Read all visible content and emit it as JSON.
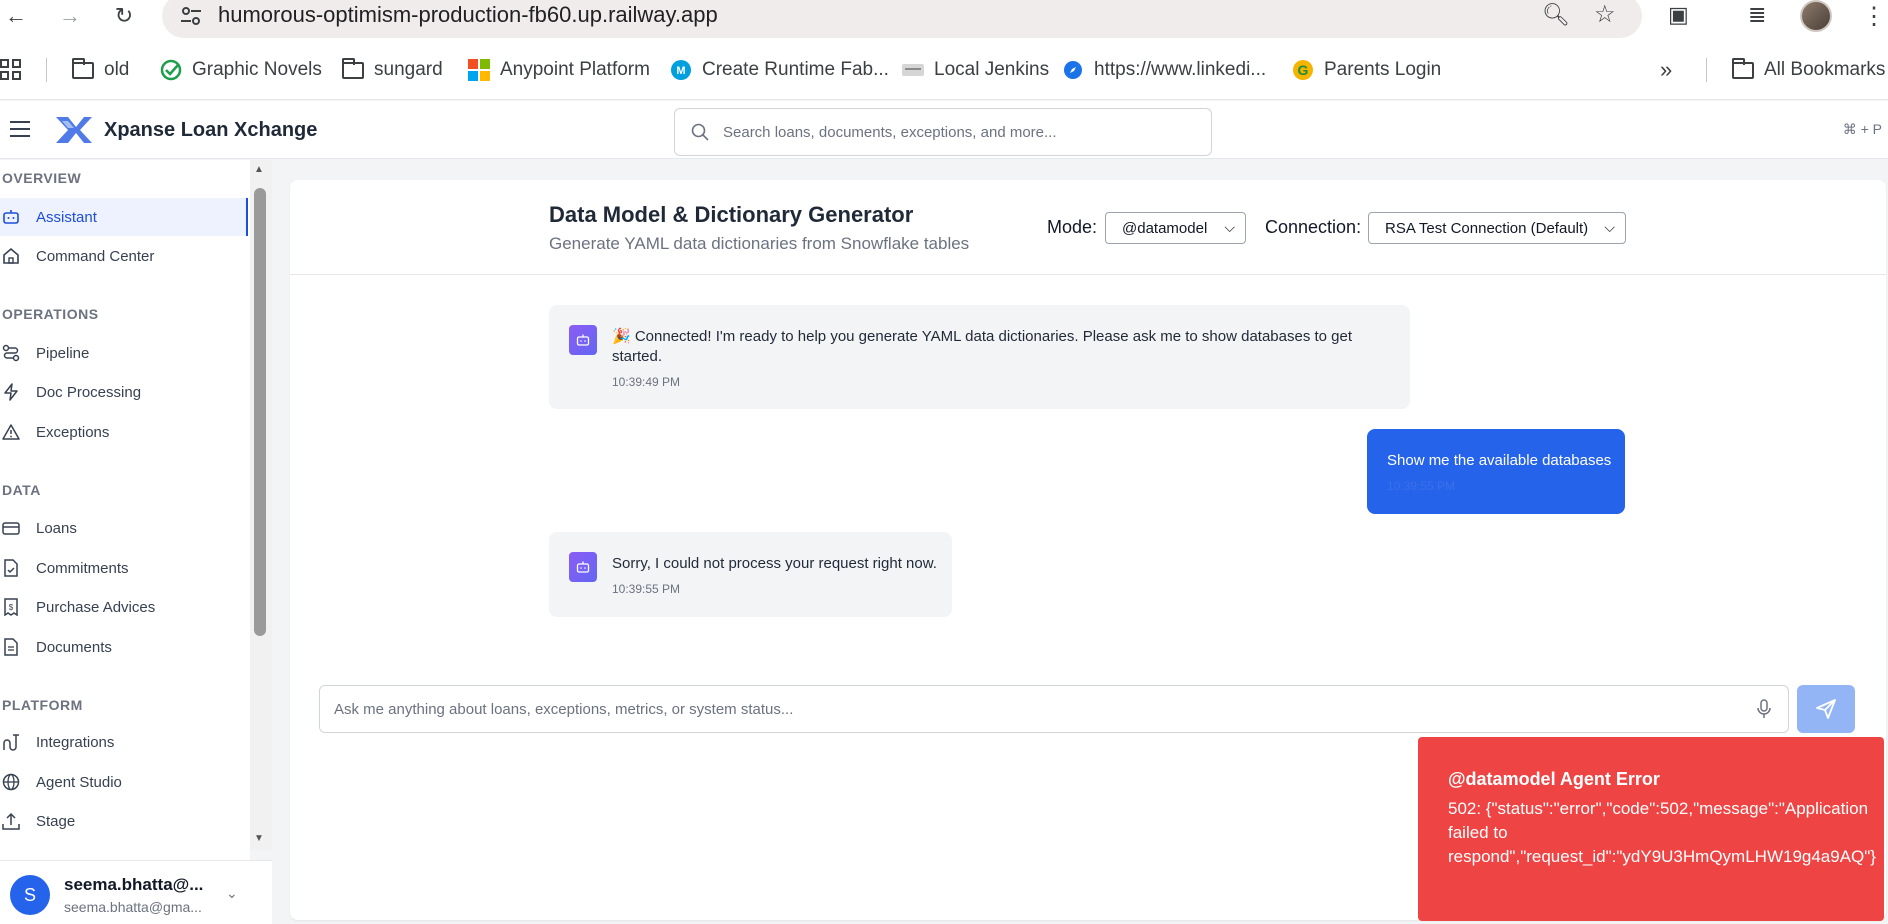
{
  "browser": {
    "url": "humorous-optimism-production-fb60.up.railway.app",
    "bookmarks": [
      {
        "label": "old",
        "icon": "folder-icon"
      },
      {
        "label": "Graphic Novels",
        "icon": "check-circle-icon"
      },
      {
        "label": "sungard",
        "icon": "folder-icon"
      },
      {
        "label": "Anypoint Platform",
        "icon": "microsoft-icon"
      },
      {
        "label": "Create Runtime Fab...",
        "icon": "mulesoft-icon"
      },
      {
        "label": "Local Jenkins",
        "icon": "card-icon"
      },
      {
        "label": "https://www.linkedi...",
        "icon": "compass-icon"
      },
      {
        "label": "Parents Login",
        "icon": "g-logo-icon"
      }
    ],
    "overflow": "»",
    "all_bookmarks": "All Bookmarks"
  },
  "header": {
    "brand": "Xpanse Loan Xchange",
    "search_placeholder": "Search loans, documents, exceptions, and more...",
    "shortcut": "⌘ + P"
  },
  "sidebar": {
    "sections": {
      "overview": "OVERVIEW",
      "operations": "OPERATIONS",
      "data": "DATA",
      "platform": "PLATFORM"
    },
    "items": {
      "assistant": "Assistant",
      "command_center": "Command Center",
      "pipeline": "Pipeline",
      "doc_processing": "Doc Processing",
      "exceptions": "Exceptions",
      "loans": "Loans",
      "commitments": "Commitments",
      "purchase_advices": "Purchase Advices",
      "documents": "Documents",
      "integrations": "Integrations",
      "agent_studio": "Agent Studio",
      "stage": "Stage"
    },
    "user": {
      "initial": "S",
      "name": "seema.bhatta@...",
      "email": "seema.bhatta@gma..."
    }
  },
  "main": {
    "title": "Data Model & Dictionary Generator",
    "subtitle": "Generate YAML data dictionaries from Snowflake tables",
    "mode_label": "Mode:",
    "mode_value": "@datamodel",
    "connection_label": "Connection:",
    "connection_value": "RSA Test Connection (Default)",
    "messages": [
      {
        "role": "bot",
        "line1": "🎉 Connected! I'm ready to help you generate YAML data dictionaries. Please ask me to show databases to get",
        "line2": "started.",
        "time": "10:39:49 PM"
      },
      {
        "role": "user",
        "text": "Show me the available databases",
        "time": "10:39:55 PM"
      },
      {
        "role": "bot",
        "text": "Sorry, I could not process your request right now.",
        "time": "10:39:55 PM"
      }
    ],
    "composer_placeholder": "Ask me anything about loans, exceptions, metrics, or system status..."
  },
  "toast": {
    "title": "@datamodel Agent Error",
    "body": "502: {\"status\":\"error\",\"code\":502,\"message\":\"Application failed to respond\",\"request_id\":\"ydY9U3HmQymLHW19g4a9AQ\"}"
  },
  "colors": {
    "accent": "#2563eb",
    "error": "#ef4444",
    "active_bg": "#eef2ff"
  }
}
